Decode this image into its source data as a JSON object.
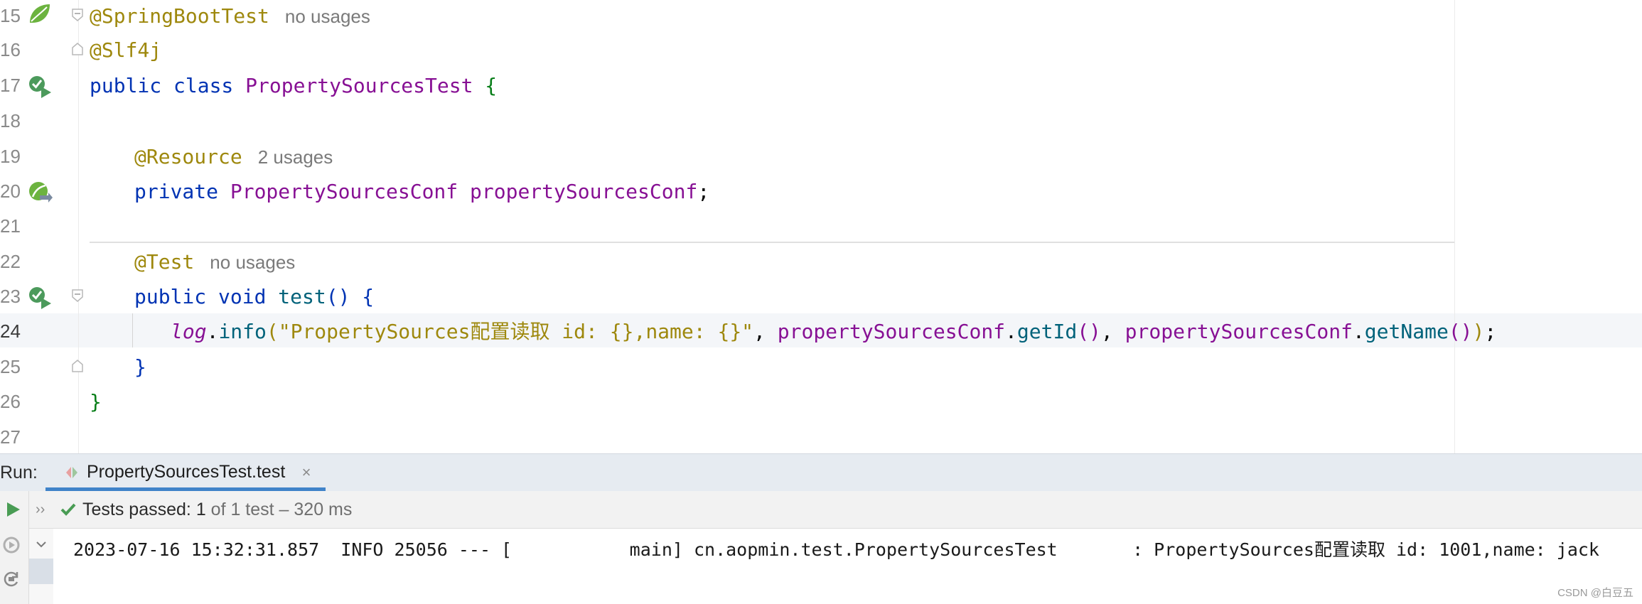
{
  "editor": {
    "lines": [
      {
        "num": "15",
        "annotation": "@SpringBootTest",
        "hint": "no usages"
      },
      {
        "num": "16",
        "annotation": "@Slf4j"
      },
      {
        "num": "17",
        "kw": "public class ",
        "cls": "PropertySourcesTest",
        "brace": " {"
      },
      {
        "num": "18"
      },
      {
        "num": "19",
        "annotation": "@Resource",
        "hint": "2 usages"
      },
      {
        "num": "20",
        "kw": "private ",
        "type": "PropertySourcesConf",
        "field": " propertySourcesConf",
        "semi": ";"
      },
      {
        "num": "21"
      },
      {
        "num": "22",
        "annotation": "@Test",
        "hint": "no usages"
      },
      {
        "num": "23",
        "kw": "public void ",
        "method": "test",
        "parens": "()",
        "brace": " {"
      },
      {
        "num": "24",
        "log": "log",
        "dot1": ".",
        "info": "info",
        "paren_open": "(",
        "string": "\"PropertySources配置读取 id: {},name: {}\"",
        "comma1": ", ",
        "obj1": "propertySourcesConf",
        "dot2": ".",
        "getId": "getId",
        "call1": "()",
        "comma2": ", ",
        "obj2": "propertySourcesConf",
        "dot3": ".",
        "getName": "getName",
        "call2": "()",
        "paren_close": ")",
        "semi": ";"
      },
      {
        "num": "25",
        "brace": "}"
      },
      {
        "num": "26",
        "brace": "}"
      },
      {
        "num": "27"
      }
    ]
  },
  "run": {
    "label": "Run:",
    "tab_title": "PropertySourcesTest.test",
    "tab_close": "×",
    "chevrons": "››",
    "tests_passed_prefix": "Tests passed: ",
    "tests_passed_count": "1",
    "tests_passed_suffix": " of 1 test – 320 ms",
    "console_line": "2023-07-16 15:32:31.857  INFO 25056 --- [           main] cn.aopmin.test.PropertySourcesTest       : PropertySources配置读取 id: 1001,name: jack"
  },
  "watermark": "CSDN @白豆五",
  "colors": {
    "annotation": "#9e880d",
    "keyword": "#0033b3",
    "class": "#871094",
    "string": "#067d17",
    "method": "#00627a",
    "run_accent": "#4083c9",
    "pass_green": "#499c54"
  }
}
